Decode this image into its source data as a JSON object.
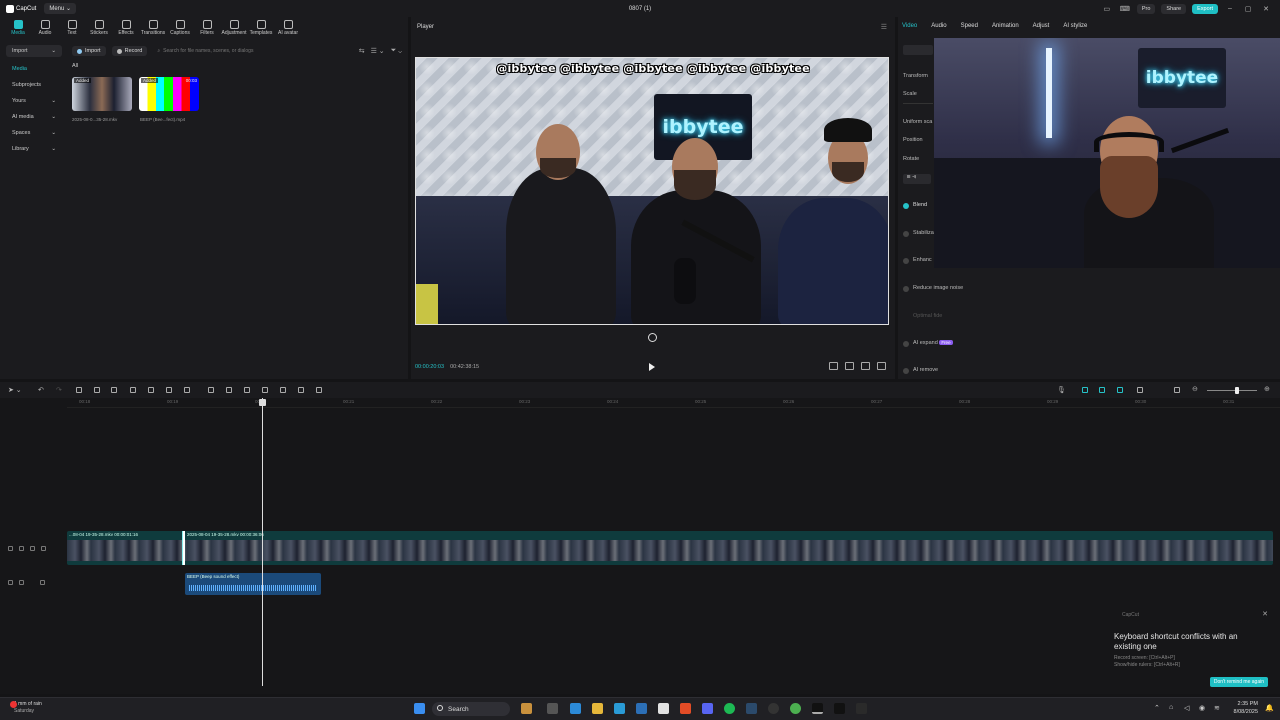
{
  "app": {
    "logo_label": "CapCut",
    "menu_label": "Menu",
    "project_title": "0807 (1)",
    "pro_label": "Pro",
    "share_label": "Share",
    "export_label": "Export",
    "accent": "#1fbfc4"
  },
  "media_tabs": [
    "Media",
    "Audio",
    "Text",
    "Stickers",
    "Effects",
    "Transitions",
    "Captions",
    "Filters",
    "Adjustment",
    "Templates",
    "AI avatar"
  ],
  "media_sidebar": [
    {
      "label": "Import",
      "chev": "⌄"
    },
    {
      "label": "Media",
      "chev": ""
    },
    {
      "label": "Subprojects",
      "chev": ""
    },
    {
      "label": "Yours",
      "chev": "⌄"
    },
    {
      "label": "AI media",
      "chev": "⌄"
    },
    {
      "label": "Spaces",
      "chev": "⌄"
    },
    {
      "label": "Library",
      "chev": "⌄"
    }
  ],
  "media_toolbar": {
    "import_label": "Import",
    "record_label": "Record",
    "search_placeholder": "Search for file names, scenes, or dialogs",
    "filter_all": "All"
  },
  "media_items": [
    {
      "tag": "Added",
      "duration": "",
      "caption": "2025-08-0...35-28.mkv"
    },
    {
      "tag": "Added",
      "duration": "00:03",
      "caption": "BEEP (Bee...fect).mp4"
    }
  ],
  "player": {
    "header": "Player",
    "current_time": "00:00:20:03",
    "total_time": "00:42:38:15",
    "overlay_socials": "@ibbytee @ibbytee @ibbytee @ibbytee @ibbytee",
    "neon_sign": "ibbytee"
  },
  "properties": {
    "tabs": [
      "Video",
      "Audio",
      "Speed",
      "Animation",
      "Adjust",
      "AI stylize"
    ],
    "transform": "Transform",
    "scale": "Scale",
    "uniform_scale": "Uniform sca",
    "position": "Position",
    "rotate": "Rotate",
    "blend": "Blend",
    "stabilize": "Stabiliza",
    "enhance": "Enhanc",
    "reduce_noise": "Reduce image noise",
    "optimal_fidelity": "Optimal fide",
    "ai_expand": "AI expand",
    "ai_expand_badge": "Free",
    "ai_remove": "AI remove"
  },
  "timeline": {
    "ruler_ticks": [
      "00:18",
      "00:19",
      "00:20",
      "00:21",
      "00:22",
      "00:23",
      "00:24",
      "00:25",
      "00:26",
      "00:27",
      "00:28",
      "00:29",
      "00:30",
      "00:31"
    ],
    "clip1_label": "...08-04 19-35-28.mkv  00:00:01:16",
    "clip2_label": "2025-08-04 19-35-28.mkv  00:00:36:06",
    "audio_label": "BEEP (Beep sound effect)"
  },
  "notification": {
    "app": "CapCut",
    "title": "Keyboard shortcut conflicts with an existing one",
    "line1": "Record screen: [Ctrl+Alt+P]",
    "line2": "Show/hide rulers: [Ctrl+Alt+R]",
    "button": "Don't remind me again"
  },
  "taskbar": {
    "weather_main": "1 mm of rain",
    "weather_sub": "Saturday",
    "search": "Search",
    "time": "2:35 PM",
    "date": "8/08/2025"
  }
}
